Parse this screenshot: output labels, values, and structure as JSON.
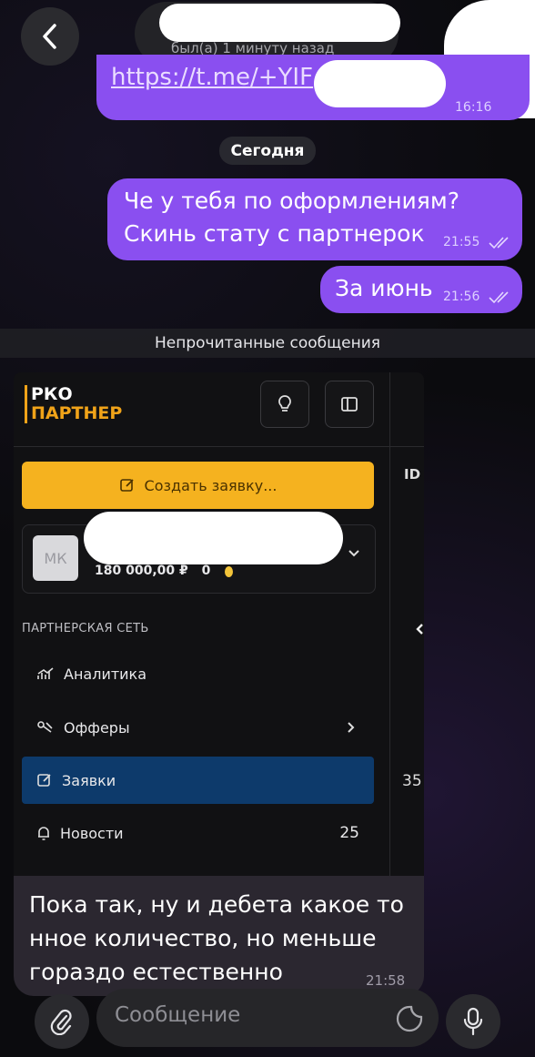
{
  "header": {
    "status": "был(а) 1 минуту назад",
    "back_icon": "chevron-left-icon"
  },
  "messages": {
    "link": {
      "text": "https://t.me/+YIF",
      "time": "16:16"
    },
    "date_separator": "Сегодня",
    "msg1": {
      "line1": "Че у тебя по оформлениям?",
      "line2": "Скинь стату с партнерок",
      "time": "21:55"
    },
    "msg2": {
      "text": "За июнь",
      "time": "21:56"
    },
    "unread_label": "Непрочитанные сообщения",
    "msg3": {
      "text": "Пока так, ну и дебета какое то нное количество, но меньше гораздо естественно",
      "time": "21:58"
    }
  },
  "screenshot": {
    "brand_line1": "РКО",
    "brand_line2": "ПАРТНЕР",
    "id_header": "ID",
    "create_button": "Создать заявку...",
    "avatar_initials": "МК",
    "balance": "180 000,00 ₽",
    "coins": "0",
    "section_title": "ПАРТНЕРСКАЯ СЕТЬ",
    "nav": [
      {
        "label": "Аналитика",
        "icon": "chart-icon",
        "count": ""
      },
      {
        "label": "Офферы",
        "icon": "offers-icon",
        "count": ""
      },
      {
        "label": "Заявки",
        "icon": "edit-icon",
        "count": ""
      },
      {
        "label": "Новости",
        "icon": "bell-icon",
        "count": "25"
      }
    ],
    "side_value": "35"
  },
  "input": {
    "placeholder": "Сообщение"
  },
  "colors": {
    "outgoing_bubble": "#8a4ff0",
    "brand_accent": "#f0a319",
    "active_nav": "#0d3a6b"
  }
}
